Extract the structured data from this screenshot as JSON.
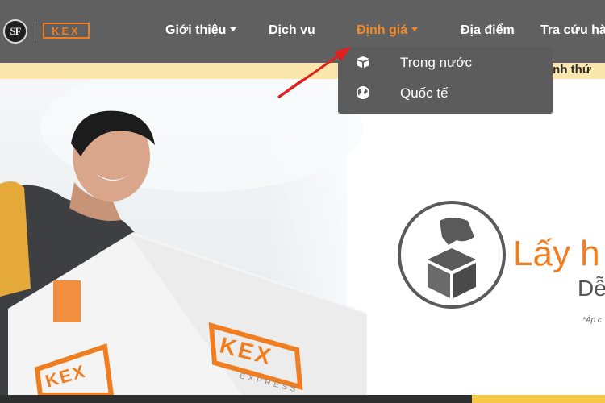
{
  "header": {
    "logo_sf": "SF",
    "logo_kex": "KEX",
    "nav": [
      {
        "label": "Giới thiệu",
        "has_caret": true
      },
      {
        "label": "Dịch vụ",
        "has_caret": false
      },
      {
        "label": "Định giá",
        "has_caret": true,
        "active": true
      },
      {
        "label": "Địa điểm",
        "has_caret": false
      },
      {
        "label": "Tra cứu hà",
        "has_caret": false
      }
    ]
  },
  "dropdown": {
    "items": [
      {
        "label": "Trong nước",
        "icon": "box-icon"
      },
      {
        "label": "Quốc tế",
        "icon": "globe-icon"
      }
    ]
  },
  "strip": {
    "text": "ính thứ"
  },
  "hero": {
    "slogan": "Lấy h",
    "slogan_sub": "Dễ",
    "note": "*Áp c",
    "box_brand": "KEX",
    "box_sub": "EXPRESS"
  },
  "colors": {
    "header_bg": "#606060",
    "accent": "#f07d1f",
    "strip_bg": "#fbe7ad",
    "dropdown_bg": "#5c5c5c",
    "arrow": "#e02020"
  }
}
